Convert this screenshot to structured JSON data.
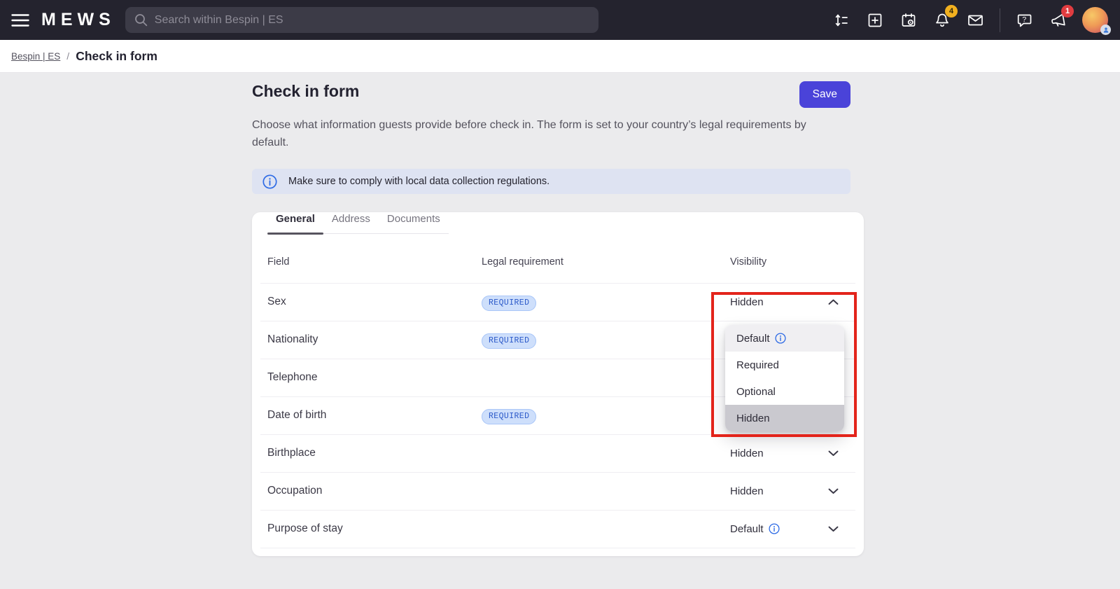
{
  "topbar": {
    "logo": "MEWS",
    "search_placeholder": "Search within Bespin | ES",
    "notifications_count": "4",
    "whats_new_count": "1"
  },
  "breadcrumb": {
    "property": "Bespin | ES",
    "separator": "/",
    "page": "Check in form"
  },
  "page": {
    "title": "Check in form",
    "description": "Choose what information guests provide before check in. The form is set to your country’s legal requirements by default.",
    "save_button": "Save",
    "banner_text": "Make sure to comply with local data collection regulations."
  },
  "tabs": [
    {
      "label": "General",
      "active": true
    },
    {
      "label": "Address",
      "active": false
    },
    {
      "label": "Documents",
      "active": false
    }
  ],
  "table": {
    "columns": [
      "Field",
      "Legal requirement",
      "Visibility"
    ],
    "rows": [
      {
        "field": "Sex",
        "legal_badge": "REQUIRED",
        "visibility": "Hidden",
        "visibility_info": false,
        "dropdown_open": true,
        "covered": false
      },
      {
        "field": "Nationality",
        "legal_badge": "REQUIRED",
        "visibility": "",
        "visibility_info": false,
        "dropdown_open": false,
        "covered": true
      },
      {
        "field": "Telephone",
        "legal_badge": "",
        "visibility": "",
        "visibility_info": false,
        "dropdown_open": false,
        "covered": true
      },
      {
        "field": "Date of birth",
        "legal_badge": "REQUIRED",
        "visibility": "",
        "visibility_info": false,
        "dropdown_open": false,
        "covered": true
      },
      {
        "field": "Birthplace",
        "legal_badge": "",
        "visibility": "Hidden",
        "visibility_info": false,
        "dropdown_open": false,
        "covered": false
      },
      {
        "field": "Occupation",
        "legal_badge": "",
        "visibility": "Hidden",
        "visibility_info": false,
        "dropdown_open": false,
        "covered": false
      },
      {
        "field": "Purpose of stay",
        "legal_badge": "",
        "visibility": "Default",
        "visibility_info": true,
        "dropdown_open": false,
        "covered": false
      }
    ]
  },
  "dropdown": {
    "options": [
      {
        "label": "Default",
        "info": true,
        "state": "hover"
      },
      {
        "label": "Required",
        "info": false,
        "state": ""
      },
      {
        "label": "Optional",
        "info": false,
        "state": ""
      },
      {
        "label": "Hidden",
        "info": false,
        "state": "selected"
      }
    ]
  },
  "colors": {
    "accent": "#4A43D9",
    "annotation_red": "#E3241B",
    "notification_badge": "#F2B01F",
    "alert_badge": "#E13C40",
    "required_badge_bg": "#CEDFFB",
    "required_badge_text": "#2B59C9",
    "banner_bg": "#DEE3F2",
    "info_icon_blue": "#2E6BE5",
    "topbar_bg": "#24232E"
  }
}
